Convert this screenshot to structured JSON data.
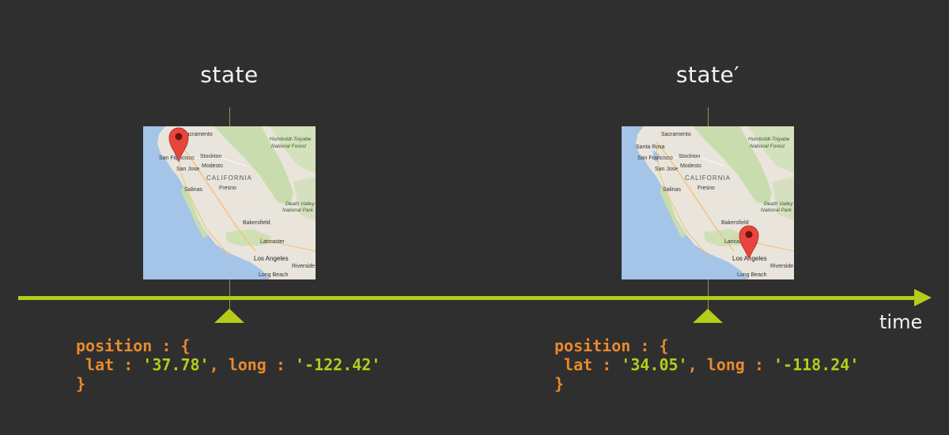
{
  "states": [
    {
      "label": "state",
      "map": {
        "cities": {
          "sacramento": "Sacramento",
          "san_francisco": "San Francisco",
          "stockton": "Stockton",
          "san_jose": "San Jose",
          "modesto": "Modesto",
          "california": "CALIFORNIA",
          "salinas": "Salinas",
          "fresno": "Fresno",
          "bakersfield": "Bakersfield",
          "lancaster": "Lancaster",
          "los_angeles": "Los Angeles",
          "riverside": "Riverside",
          "long_beach": "Long Beach",
          "humboldt_1": "Humboldt-Toiyabe",
          "humboldt_2": "National Forest",
          "death_valley_1": "Death Valley",
          "death_valley_2": "National Park"
        },
        "pin": "San Francisco"
      },
      "code": {
        "key": "position",
        "colon": " : ",
        "open": "{",
        "lat_key": "lat",
        "lat_val": "'37.78'",
        "long_key": "long",
        "long_val": "'-122.42'",
        "close": "}"
      }
    },
    {
      "label": "state′",
      "map": {
        "cities": {
          "sacramento": "Sacramento",
          "santa_rosa": "Santa Rosa",
          "san_francisco": "San Francisco",
          "stockton": "Stockton",
          "san_jose": "San Jose",
          "modesto": "Modesto",
          "california": "CALIFORNIA",
          "salinas": "Salinas",
          "fresno": "Fresno",
          "bakersfield": "Bakersfield",
          "lancaster": "Lancaster",
          "los_angeles": "Los Angeles",
          "riverside": "Riverside",
          "long_beach": "Long Beach",
          "humboldt_1": "Humboldt-Toiyabe",
          "humboldt_2": "National Forest",
          "death_valley_1": "Death Valley",
          "death_valley_2": "National Park"
        },
        "pin": "Los Angeles"
      },
      "code": {
        "key": "position",
        "colon": " : ",
        "open": "{",
        "lat_key": "lat",
        "lat_val": "'34.05'",
        "long_key": "long",
        "long_val": "'-118.24'",
        "close": "}"
      }
    }
  ],
  "timeline": {
    "label": "time"
  },
  "colors": {
    "background": "#2f2f2f",
    "accent": "#b5cc1a",
    "keyword": "#e88a2e",
    "text": "#f2f2f2"
  }
}
